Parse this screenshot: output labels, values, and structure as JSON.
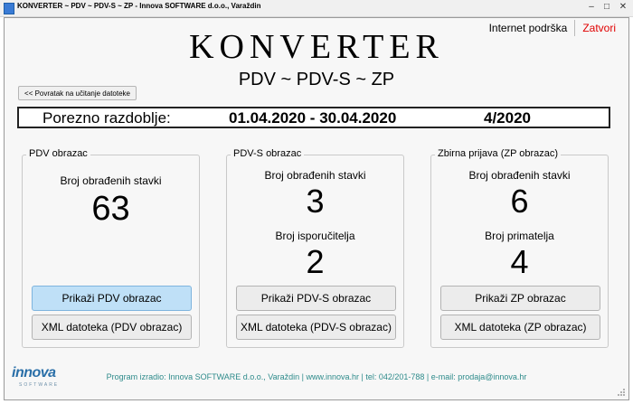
{
  "window": {
    "title": "KONVERTER ~ PDV ~ PDV-S ~ ZP - Innova SOFTWARE d.o.o., Varaždin",
    "minimize_icon": "minimize-icon",
    "maximize_icon": "maximize-icon",
    "close_icon": "close-icon"
  },
  "toplinks": {
    "support": "Internet podrška",
    "close": "Zatvori",
    "close_color": "#e00000"
  },
  "header": {
    "title": "KONVERTER",
    "subtitle": "PDV ~ PDV-S ~ ZP",
    "back_button": "<<  Povratak na učitanje datoteke"
  },
  "period": {
    "label": "Porezno razdoblje:",
    "range": "01.04.2020 - 30.04.2020",
    "number": "4/2020"
  },
  "groups": {
    "pdv": {
      "legend": "PDV obrazac",
      "stat1_label": "Broj obrađenih stavki",
      "stat1_value": "63",
      "show_button": "Prikaži PDV obrazac",
      "xml_button": "XML datoteka (PDV obrazac)"
    },
    "pdvs": {
      "legend": "PDV-S obrazac",
      "stat1_label": "Broj obrađenih stavki",
      "stat1_value": "3",
      "stat2_label": "Broj isporučitelja",
      "stat2_value": "2",
      "show_button": "Prikaži PDV-S obrazac",
      "xml_button": "XML datoteka (PDV-S obrazac)"
    },
    "zp": {
      "legend": "Zbirna prijava (ZP obrazac)",
      "stat1_label": "Broj obrađenih stavki",
      "stat1_value": "6",
      "stat2_label": "Broj primatelja",
      "stat2_value": "4",
      "show_button": "Prikaži ZP obrazac",
      "xml_button": "XML datoteka (ZP obrazac)"
    }
  },
  "footer": {
    "text": "Program izradio:  Innova SOFTWARE d.o.o., Varaždin  |  www.innova.hr  |  tel: 042/201-788  |  e-mail: prodaja@innova.hr",
    "logo_text": "innova",
    "logo_sub": "SOFTWARE"
  },
  "colors": {
    "accent_button": "#bfe0f7",
    "footer_text": "#2e8b8b",
    "logo": "#2a6fa8"
  }
}
